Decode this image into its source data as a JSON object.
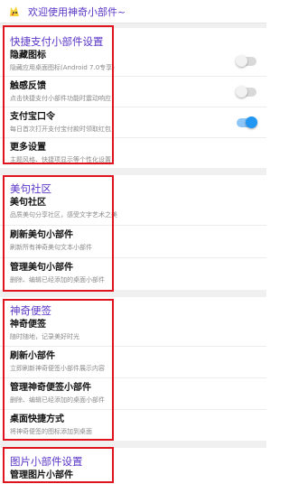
{
  "header": {
    "welcome_text": "欢迎使用神奇小部件~",
    "app_icon": "yellow-mascot-icon"
  },
  "sections": [
    {
      "title": "快捷支付小部件设置",
      "items": [
        {
          "label": "隐藏图标",
          "desc": "隐藏应用桌面图标(Android 7.0专享)",
          "toggle": "off"
        },
        {
          "label": "触感反馈",
          "desc": "点击快捷支付小部件功能时震动响应",
          "toggle": "off"
        },
        {
          "label": "支付宝口令",
          "desc": "每日首次打开支付宝付款时领取红包",
          "toggle": "on"
        },
        {
          "label": "更多设置",
          "desc": "主题风格、快捷项显示等个性化设置"
        }
      ]
    },
    {
      "title": "美句社区",
      "items": [
        {
          "label": "美句社区",
          "desc": "品质美句分享社区，感受文字艺术之美"
        },
        {
          "label": "刷新美句小部件",
          "desc": "刷新所有神奇美句文本小部件"
        },
        {
          "label": "管理美句小部件",
          "desc": "删除、编辑已经添加的桌面小部件"
        }
      ]
    },
    {
      "title": "神奇便签",
      "items": [
        {
          "label": "神奇便签",
          "desc": "随时随地，记录美好时光"
        },
        {
          "label": "刷新小部件",
          "desc": "立即刷新神奇便签小部件展示内容"
        },
        {
          "label": "管理神奇便签小部件",
          "desc": "删除、编辑已经添加的桌面小部件"
        },
        {
          "label": "桌面快捷方式",
          "desc": "将神奇便签的图标添加到桌面"
        }
      ]
    },
    {
      "title": "图片小部件设置",
      "items": [
        {
          "label": "管理图片小部件",
          "desc": ""
        }
      ]
    }
  ],
  "colors": {
    "accent": "#5a35c6",
    "toggle_on": "#2196f3",
    "highlight": "#e0141e"
  }
}
